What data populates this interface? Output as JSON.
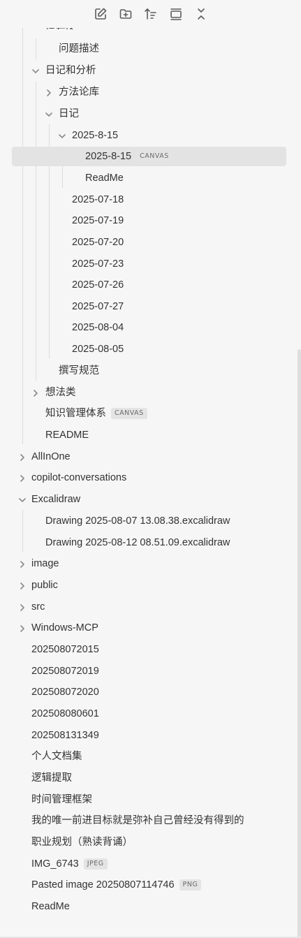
{
  "toolbar": {
    "new_note_icon": "edit-icon",
    "new_folder_icon": "folder-plus-icon",
    "sort_icon": "sort-icon",
    "collapse_icon": "layout-icon",
    "expand_icon": "collapse-all-icon"
  },
  "tree": {
    "cut_off_item": "信号区",
    "items": [
      {
        "label": "问题描述"
      },
      {
        "label": "日记和分析"
      },
      {
        "label": "方法论库"
      },
      {
        "label": "日记"
      },
      {
        "label": "2025-8-15"
      },
      {
        "label": "2025-8-15",
        "tag": "CANVAS"
      },
      {
        "label": "ReadMe"
      },
      {
        "label": "2025-07-18"
      },
      {
        "label": "2025-07-19"
      },
      {
        "label": "2025-07-20"
      },
      {
        "label": "2025-07-23"
      },
      {
        "label": "2025-07-26"
      },
      {
        "label": "2025-07-27"
      },
      {
        "label": "2025-08-04"
      },
      {
        "label": "2025-08-05"
      },
      {
        "label": "撰写规范"
      },
      {
        "label": "想法类"
      },
      {
        "label": "知识管理体系",
        "tag": "CANVAS"
      },
      {
        "label": "README"
      },
      {
        "label": "AllInOne"
      },
      {
        "label": "copilot-conversations"
      },
      {
        "label": "Excalidraw"
      },
      {
        "label": "Drawing 2025-08-07 13.08.38.excalidraw"
      },
      {
        "label": "Drawing 2025-08-12 08.51.09.excalidraw"
      },
      {
        "label": "image"
      },
      {
        "label": "public"
      },
      {
        "label": "src"
      },
      {
        "label": "Windows-MCP"
      },
      {
        "label": "202508072015"
      },
      {
        "label": "202508072019"
      },
      {
        "label": "202508072020"
      },
      {
        "label": "202508080601"
      },
      {
        "label": "202508131349"
      },
      {
        "label": "个人文档集"
      },
      {
        "label": "逻辑提取"
      },
      {
        "label": "时间管理框架"
      },
      {
        "label": "我的唯一前进目标就是弥补自己曾经没有得到的"
      },
      {
        "label": "职业规划（熟读背诵）"
      },
      {
        "label": "IMG_6743",
        "tag": "JPEG"
      },
      {
        "label": "Pasted image 20250807114746",
        "tag": "PNG"
      },
      {
        "label": "ReadMe"
      }
    ]
  }
}
